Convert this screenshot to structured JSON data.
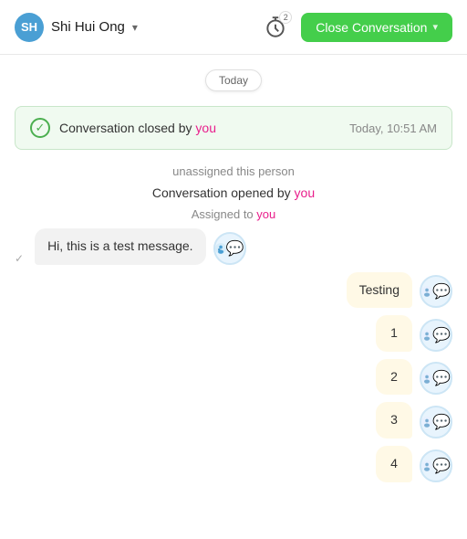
{
  "header": {
    "user_name": "Shi Hui Ong",
    "close_btn_label": "Close Conversation",
    "timer_number": "2"
  },
  "date_divider": {
    "label": "Today"
  },
  "closed_notice": {
    "text_prefix": "Conversation closed by ",
    "you_link": "you",
    "timestamp": "Today, 10:51 AM"
  },
  "activity": {
    "unassigned": "unassigned this person",
    "opened": "Conversation opened by ",
    "opened_you": "you",
    "assigned": "Assigned to ",
    "assigned_you": "you"
  },
  "messages": [
    {
      "type": "received",
      "text": "Hi, this is a test message.",
      "show_check": true
    },
    {
      "type": "sent",
      "text": "Testing"
    },
    {
      "type": "sent",
      "text": "1"
    },
    {
      "type": "sent",
      "text": "2"
    },
    {
      "type": "sent",
      "text": "3"
    },
    {
      "type": "sent",
      "text": "4"
    }
  ]
}
